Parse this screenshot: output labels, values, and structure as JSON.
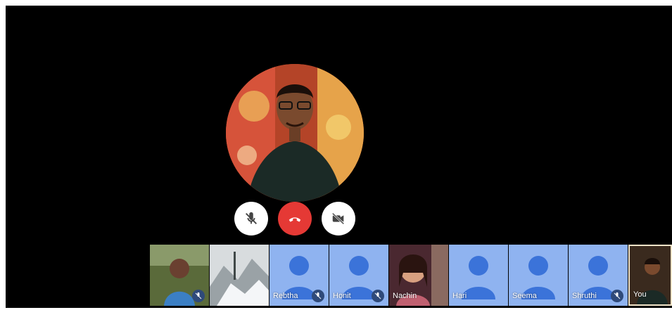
{
  "call": {
    "main_participant_avatar": "speaker-avatar"
  },
  "controls": {
    "mute_icon": "mic-off-icon",
    "end_icon": "call-end-icon",
    "video_icon": "video-off-icon"
  },
  "participants": [
    {
      "name": "",
      "type": "photo",
      "muted": true
    },
    {
      "name": "",
      "type": "photo-snow",
      "muted": false
    },
    {
      "name": "Rebtha",
      "type": "icon",
      "muted": true
    },
    {
      "name": "Honit",
      "type": "icon",
      "muted": true
    },
    {
      "name": "Nachin",
      "type": "photo-woman",
      "muted": false
    },
    {
      "name": "Hari",
      "type": "icon",
      "muted": false
    },
    {
      "name": "Seema",
      "type": "icon",
      "muted": false
    },
    {
      "name": "Shruthi",
      "type": "icon",
      "muted": true
    },
    {
      "name": "You",
      "type": "self",
      "muted": false
    }
  ],
  "colors": {
    "background": "#000000",
    "tile_bg": "#8fb3f0",
    "person_icon": "#3b73d9",
    "end_call": "#e53935"
  }
}
